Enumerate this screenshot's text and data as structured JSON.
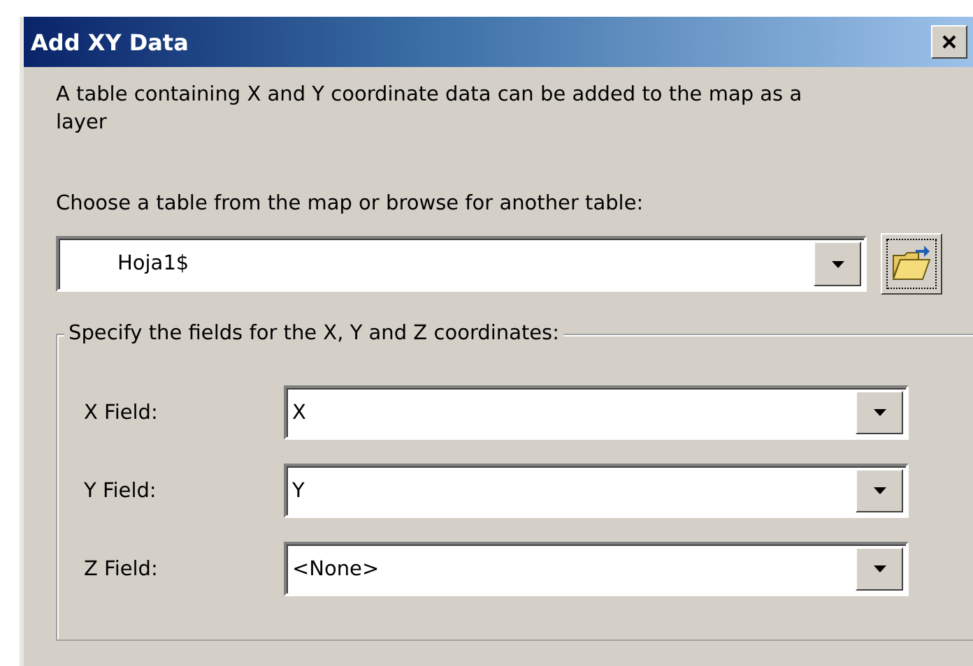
{
  "window": {
    "title": "Add XY Data"
  },
  "description": "A table containing X and Y coordinate data can be added to the map as a layer",
  "table_prompt": "Choose a table from the map or browse for another table:",
  "table_combo": {
    "value": "Hoja1$"
  },
  "coordinates_group": {
    "title": "Specify the fields for the X, Y and Z coordinates:",
    "fields": [
      {
        "label": "X Field:",
        "value": "X"
      },
      {
        "label": "Y Field:",
        "value": "Y"
      },
      {
        "label": "Z Field:",
        "value": "<None>"
      }
    ]
  }
}
